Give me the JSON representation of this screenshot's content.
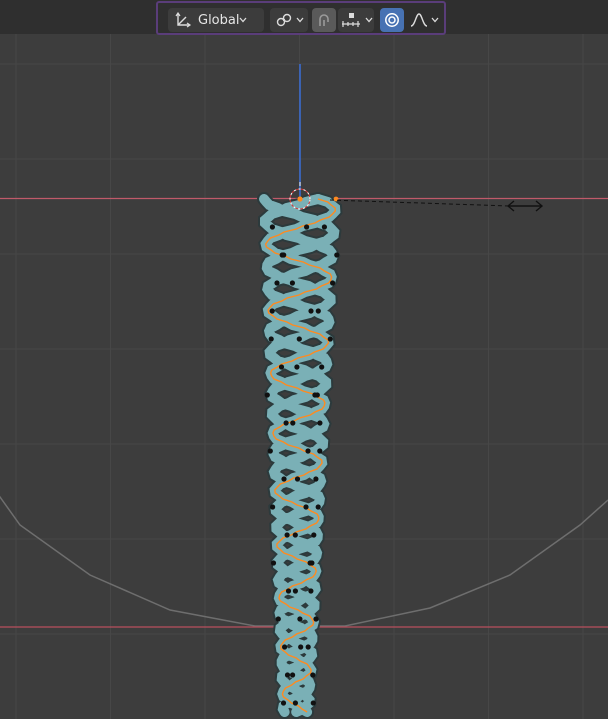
{
  "toolbar": {
    "orientation_label": "Global",
    "icons": {
      "orientation": "transform-orientation-icon",
      "pivot": "pivot-point-icon",
      "snap": "snap-magnet-icon",
      "snap_target": "snap-increment-icon",
      "proportional": "proportional-editing-icon",
      "falloff": "falloff-curve-icon"
    },
    "snap_enabled": false,
    "proportional_enabled": true,
    "highlight_color": "#5a3d7a",
    "active_color": "#4772b3"
  },
  "viewport": {
    "background": "#3d3d3d",
    "grid_color": "#474747",
    "x_axis_color": "#c55a6a",
    "z_axis_color": "#3a6fd8",
    "curve_color": "#7ab0b6",
    "control_point_color": "#111111",
    "active_point_color": "#ff8a1f"
  }
}
